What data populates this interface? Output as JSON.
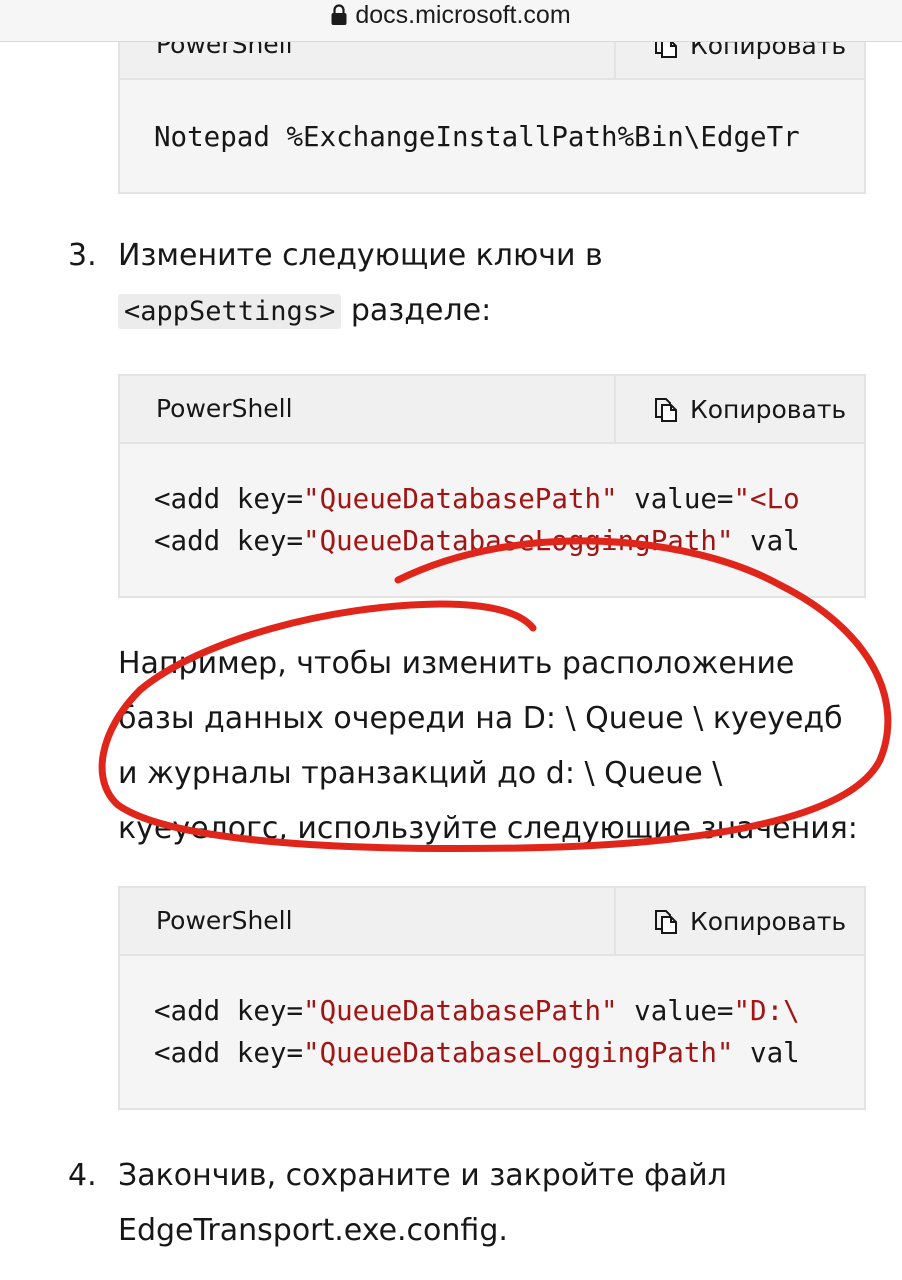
{
  "browser": {
    "url": "docs.microsoft.com"
  },
  "code_blocks": [
    {
      "language": "PowerShell",
      "copy_label": "Копировать",
      "lines": [
        [
          {
            "t": "Notepad %ExchangeInstallPath%Bin\\EdgeTr",
            "c": "plain"
          }
        ]
      ]
    },
    {
      "language": "PowerShell",
      "copy_label": "Копировать",
      "lines": [
        [
          {
            "t": "<add key=",
            "c": "plain"
          },
          {
            "t": "\"QueueDatabasePath\"",
            "c": "str"
          },
          {
            "t": " value=",
            "c": "plain"
          },
          {
            "t": "\"<Lo",
            "c": "str"
          }
        ],
        [
          {
            "t": "<add key=",
            "c": "plain"
          },
          {
            "t": "\"QueueDatabaseLoggingPath\"",
            "c": "str"
          },
          {
            "t": " val",
            "c": "plain"
          }
        ]
      ]
    },
    {
      "language": "PowerShell",
      "copy_label": "Копировать",
      "lines": [
        [
          {
            "t": "<add key=",
            "c": "plain"
          },
          {
            "t": "\"QueueDatabasePath\"",
            "c": "str"
          },
          {
            "t": " value=",
            "c": "plain"
          },
          {
            "t": "\"D:\\",
            "c": "str"
          }
        ],
        [
          {
            "t": "<add key=",
            "c": "plain"
          },
          {
            "t": "\"QueueDatabaseLoggingPath\"",
            "c": "str"
          },
          {
            "t": " val",
            "c": "plain"
          }
        ]
      ]
    }
  ],
  "steps": {
    "step3": {
      "number": "3.",
      "line1": "Измените следующие ключи в",
      "code": "<appSettings>",
      "line2_rest": " разделе:"
    },
    "example_lines": [
      "Например, чтобы изменить расположение",
      "базы данных очереди на D: \\ Queue \\ куеуедб",
      "и журналы транзакций до d: \\ Queue \\",
      "куеуелогс, используйте следующие значения:"
    ],
    "step4": {
      "number": "4.",
      "line1": "Закончив, сохраните и закройте файл",
      "line2": "EdgeTransport.exe.config."
    }
  },
  "colors": {
    "string": "#a31515",
    "annotation": "#e0261b"
  },
  "icons": {
    "lock": "lock-icon",
    "copy": "copy-icon"
  }
}
